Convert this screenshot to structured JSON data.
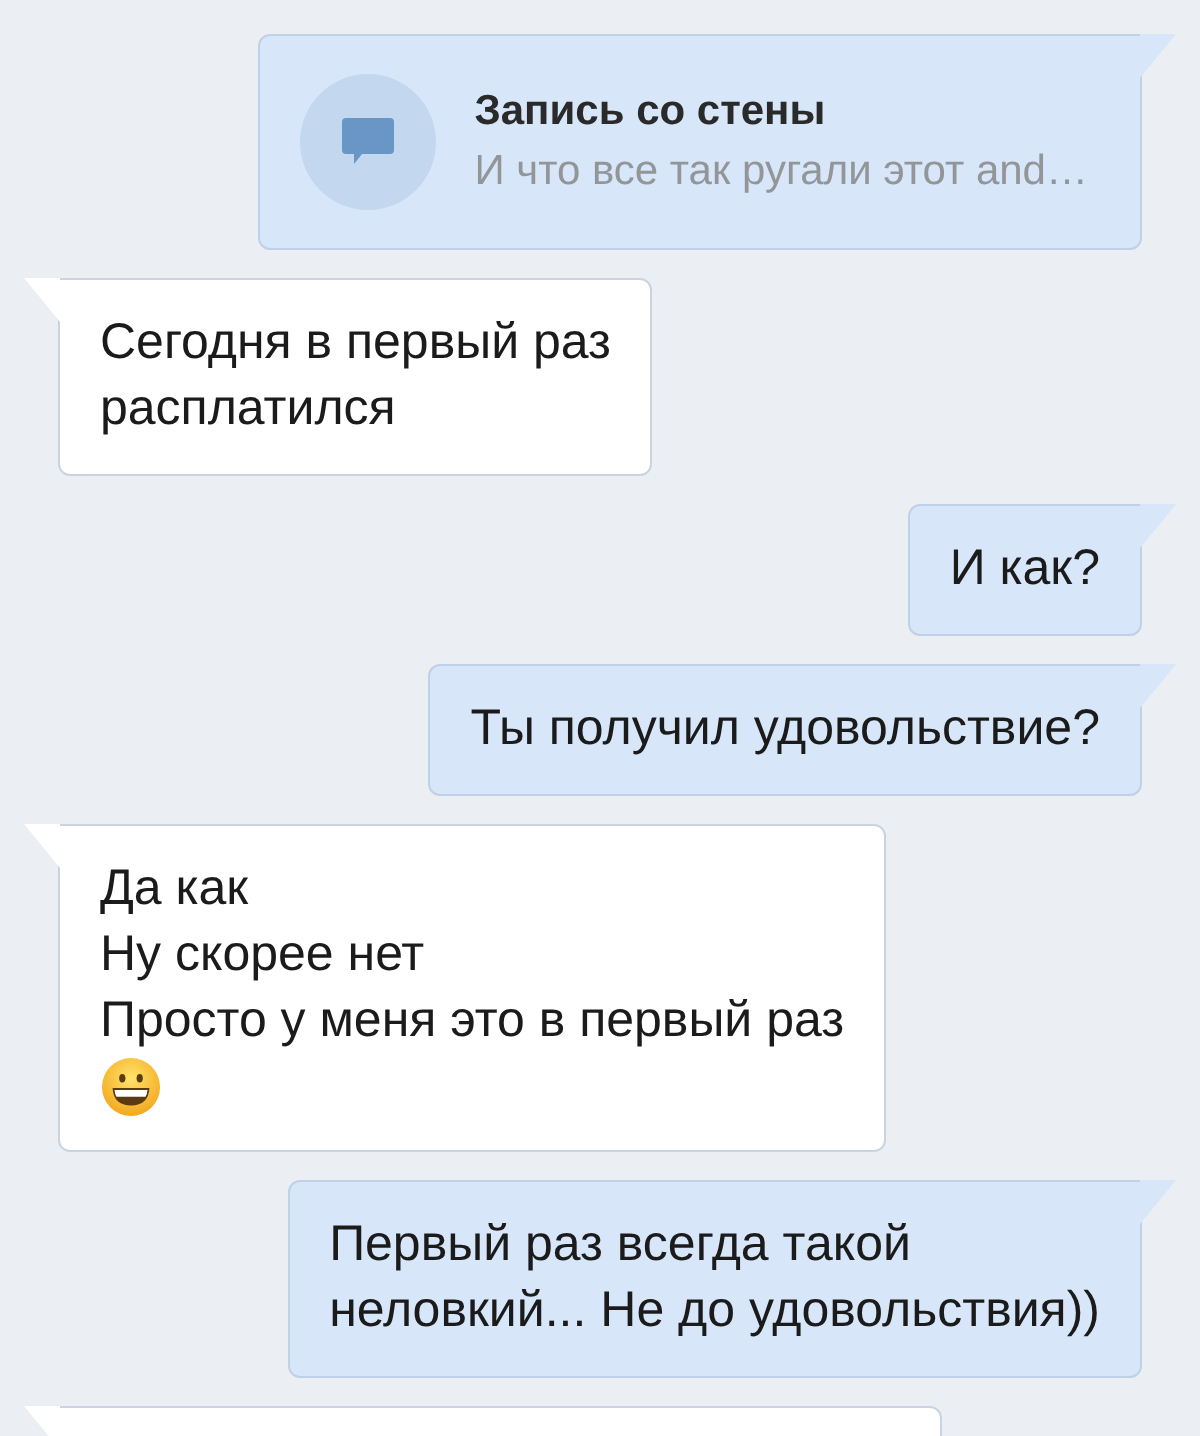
{
  "messages": [
    {
      "kind": "wall_post",
      "outgoing": true,
      "title": "Запись со стены",
      "preview": "И что все так ругали этот and…"
    },
    {
      "kind": "text",
      "outgoing": false,
      "text": "Сегодня в первый раз\nрасплатился",
      "emoji": false
    },
    {
      "kind": "text",
      "outgoing": true,
      "text": "И как?",
      "emoji": false
    },
    {
      "kind": "text",
      "outgoing": true,
      "text": "Ты получил удовольствие?",
      "emoji": false
    },
    {
      "kind": "text",
      "outgoing": false,
      "text": "Да как\nНу скорее нет\nПросто у меня это в первый раз",
      "emoji": true
    },
    {
      "kind": "text",
      "outgoing": true,
      "text": "Первый раз всегда такой\nнеловкий... Не до удовольствия))",
      "emoji": false
    },
    {
      "kind": "partial",
      "outgoing": false
    }
  ]
}
